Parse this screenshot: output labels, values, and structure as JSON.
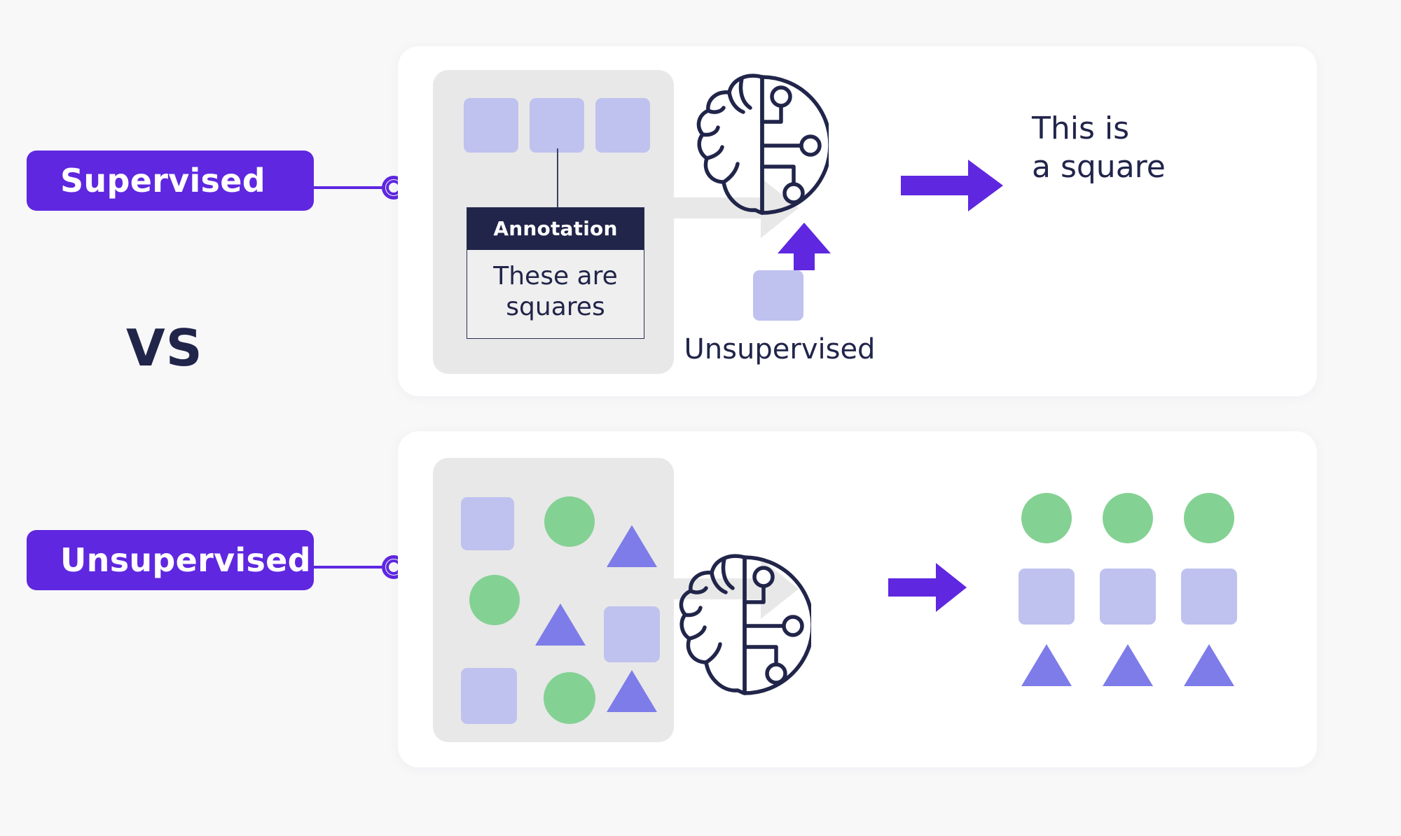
{
  "theme": {
    "page_background": "#f8f8f9",
    "card_background": "#ffffff",
    "panel_background": "#e8e8e8",
    "accent_purple": "#5f27e0",
    "dark_navy": "#21254a",
    "square_fill": "#bfc2ef",
    "circle_fill": "#84d194",
    "triangle_fill": "#7d7ce9",
    "grey_arrow": "#e8e8e8"
  },
  "left_rail": {
    "supervised_badge": "Supervised",
    "unsupervised_badge": "Unsupervised",
    "vs_label": "VS"
  },
  "supervised_panel": {
    "input_squares": [
      "square",
      "square",
      "square"
    ],
    "annotation": {
      "header": "Annotation",
      "body": "These are\nsquares"
    },
    "process_arrow": "grey-right-arrow",
    "model_icon": "brain-ai-icon",
    "output_arrow": "purple-right-arrow",
    "output_text": "This is\na square",
    "feedback": {
      "arrow": "purple-up-arrow",
      "shape": "square",
      "label": "Unsupervised"
    }
  },
  "unsupervised_panel": {
    "input_shapes": [
      {
        "row": 1,
        "col": 1,
        "type": "square"
      },
      {
        "row": 1,
        "col": 2,
        "type": "circle"
      },
      {
        "row": 1,
        "col": 3,
        "type": "triangle"
      },
      {
        "row": 2,
        "col": 1,
        "type": "circle"
      },
      {
        "row": 2,
        "col": 2,
        "type": "triangle"
      },
      {
        "row": 2,
        "col": 3,
        "type": "square"
      },
      {
        "row": 3,
        "col": 1,
        "type": "square"
      },
      {
        "row": 3,
        "col": 2,
        "type": "circle"
      },
      {
        "row": 3,
        "col": 3,
        "type": "triangle"
      }
    ],
    "process_arrow": "grey-right-arrow",
    "model_icon": "brain-ai-icon",
    "output_arrow": "purple-right-arrow",
    "output_clusters": [
      {
        "cluster": "circles",
        "type": "circle",
        "count": 3
      },
      {
        "cluster": "squares",
        "type": "square",
        "count": 3
      },
      {
        "cluster": "triangles",
        "type": "triangle",
        "count": 3
      }
    ]
  }
}
